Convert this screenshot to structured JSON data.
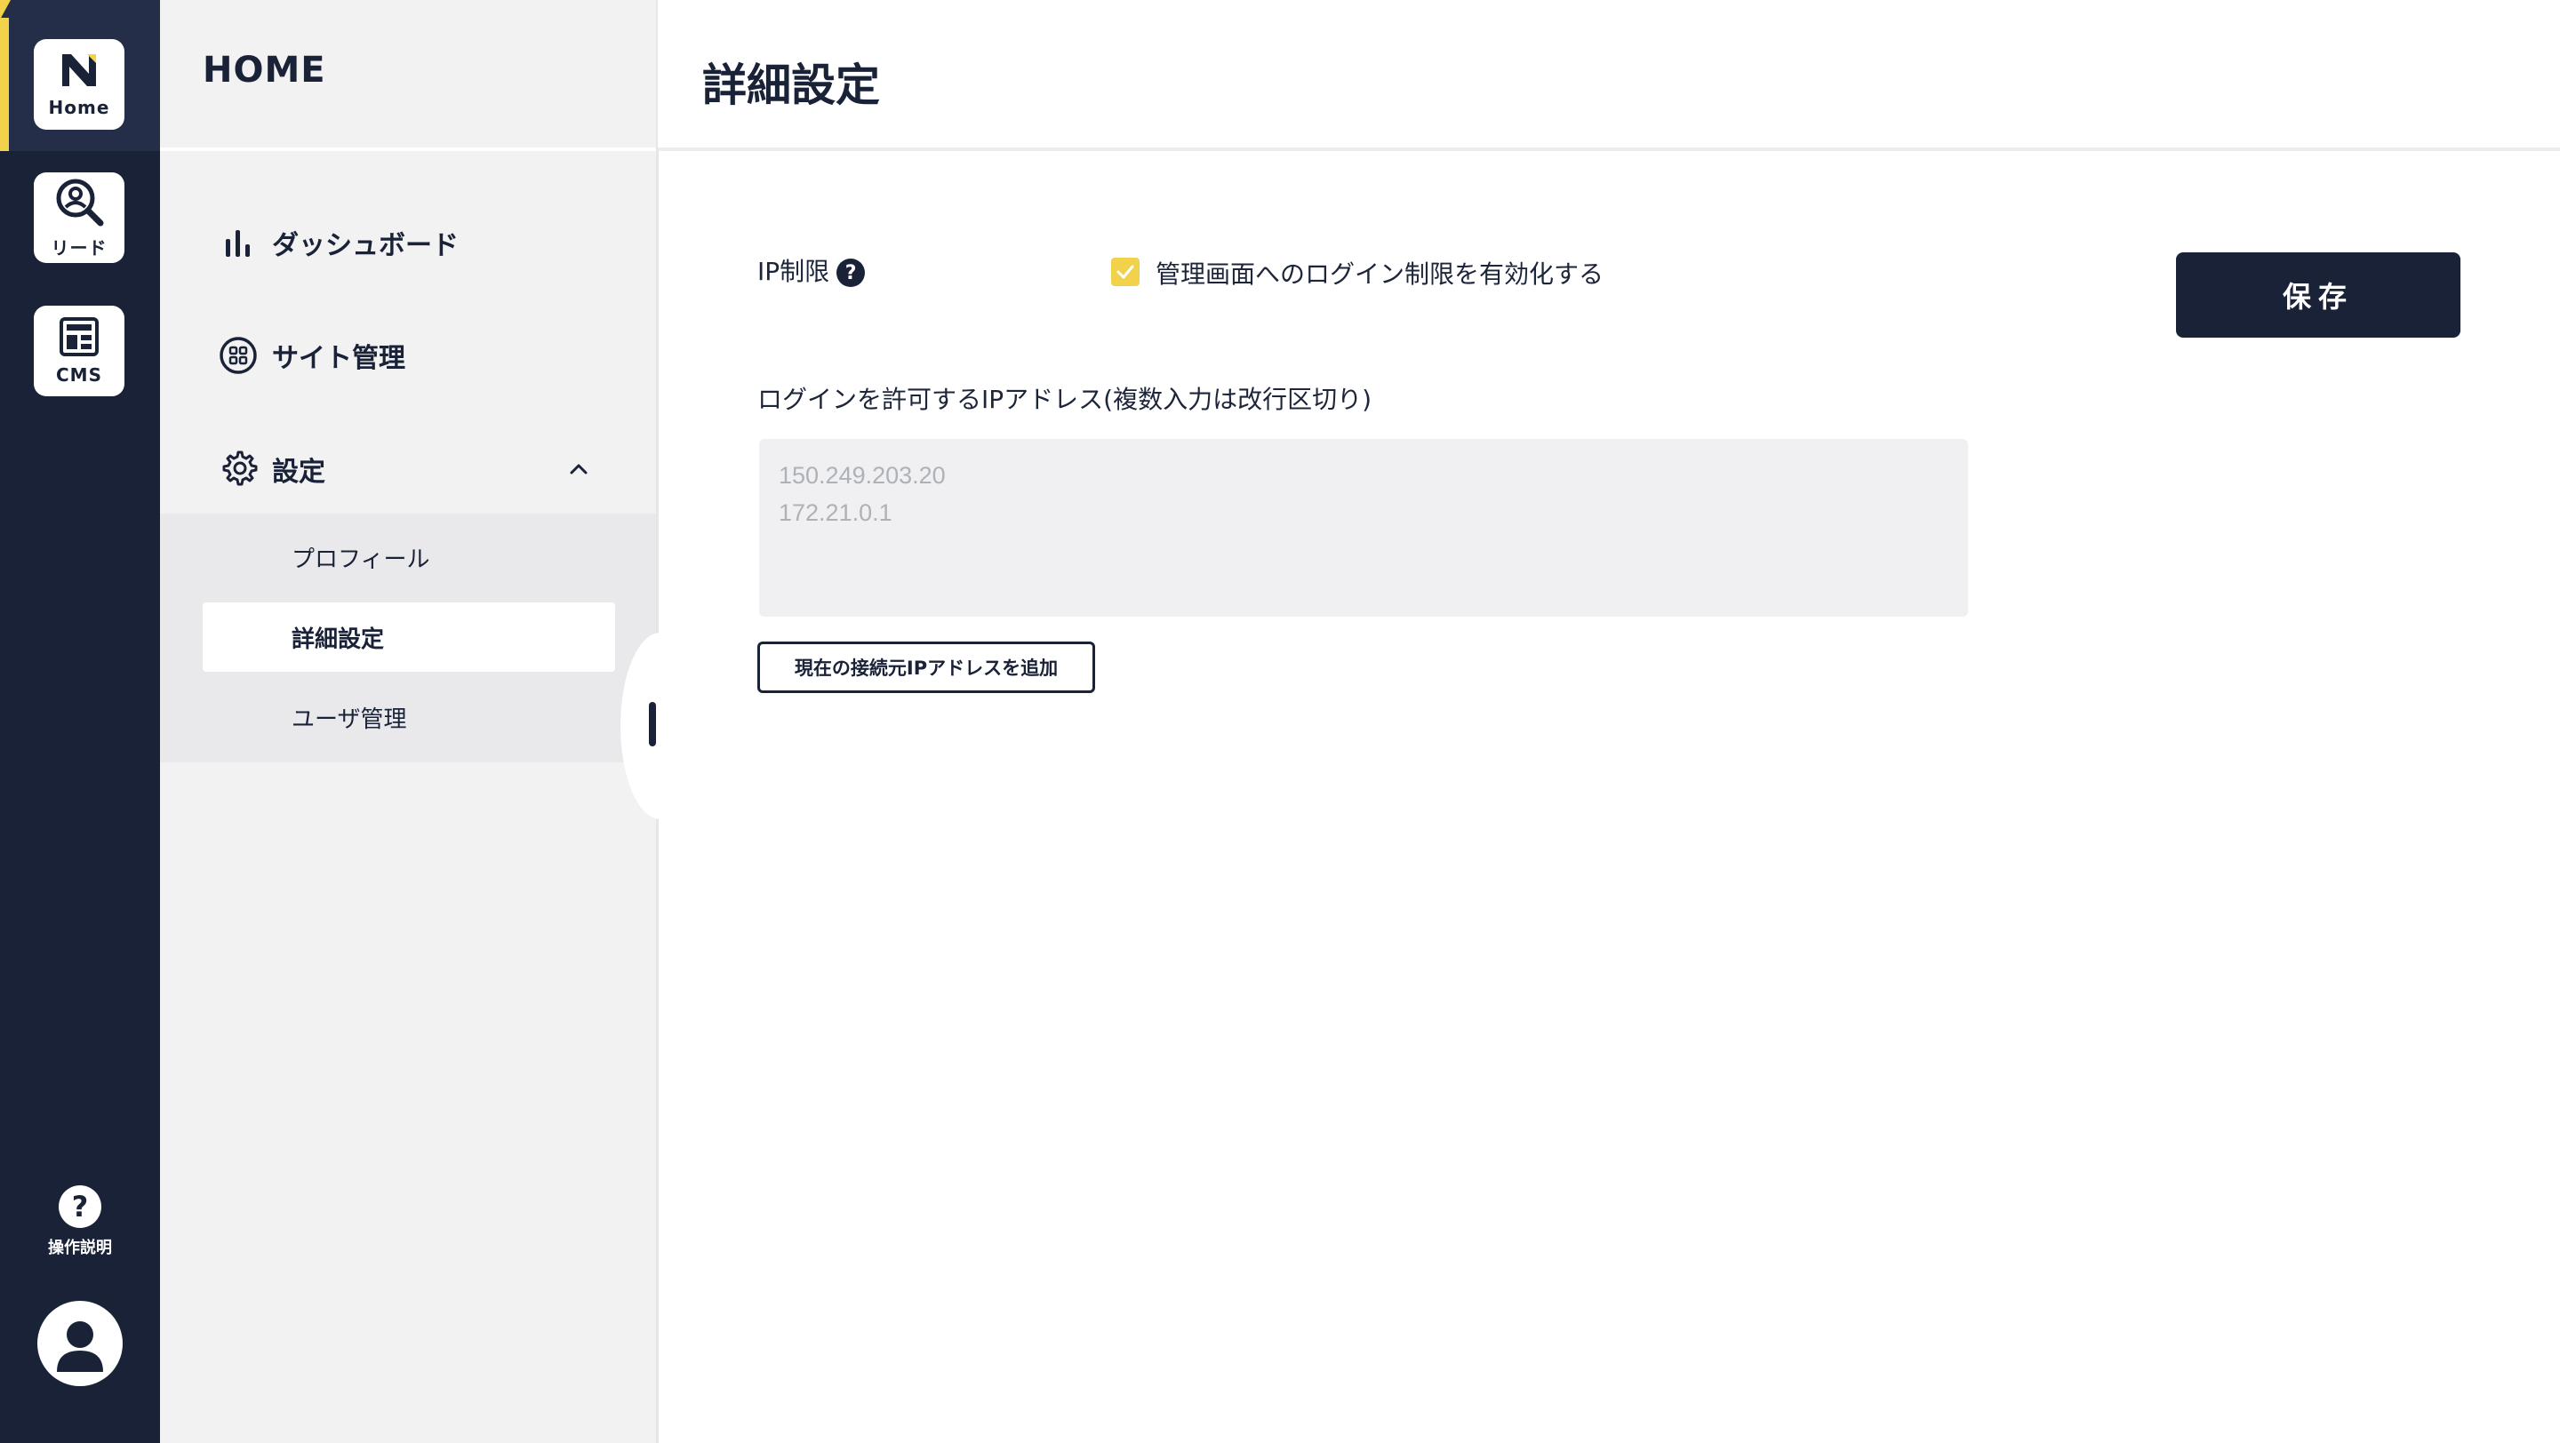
{
  "rail": {
    "items": [
      {
        "label": "Home",
        "icon": "home-logo-icon"
      },
      {
        "label": "リード",
        "icon": "lead-search-icon"
      },
      {
        "label": "CMS",
        "icon": "cms-layout-icon"
      }
    ],
    "help_label": "操作説明",
    "help_glyph": "?"
  },
  "sidebar": {
    "title": "HOME",
    "items": [
      {
        "label": "ダッシュボード",
        "icon": "bar-chart-icon"
      },
      {
        "label": "サイト管理",
        "icon": "site-grid-icon"
      },
      {
        "label": "設定",
        "icon": "gear-icon",
        "expanded": true
      }
    ],
    "submenu": [
      {
        "label": "プロフィール",
        "active": false
      },
      {
        "label": "詳細設定",
        "active": true
      },
      {
        "label": "ユーザ管理",
        "active": false
      }
    ]
  },
  "main": {
    "title": "詳細設定",
    "ip_restriction_label": "IP制限",
    "help_glyph": "?",
    "checkbox_label": "管理画面へのログイン制限を有効化する",
    "checkbox_checked": true,
    "save_label": "保存",
    "ip_list_label": "ログインを許可するIPアドレス(複数入力は改行区切り)",
    "ip_placeholder": "150.249.203.20\n172.21.0.1",
    "add_current_ip_label": "現在の接続元IPアドレスを追加"
  },
  "colors": {
    "navy": "#1a2238",
    "accent_yellow": "#f2d24b",
    "sidebar_bg": "#f2f2f3",
    "input_bg": "#f0f0f3"
  }
}
